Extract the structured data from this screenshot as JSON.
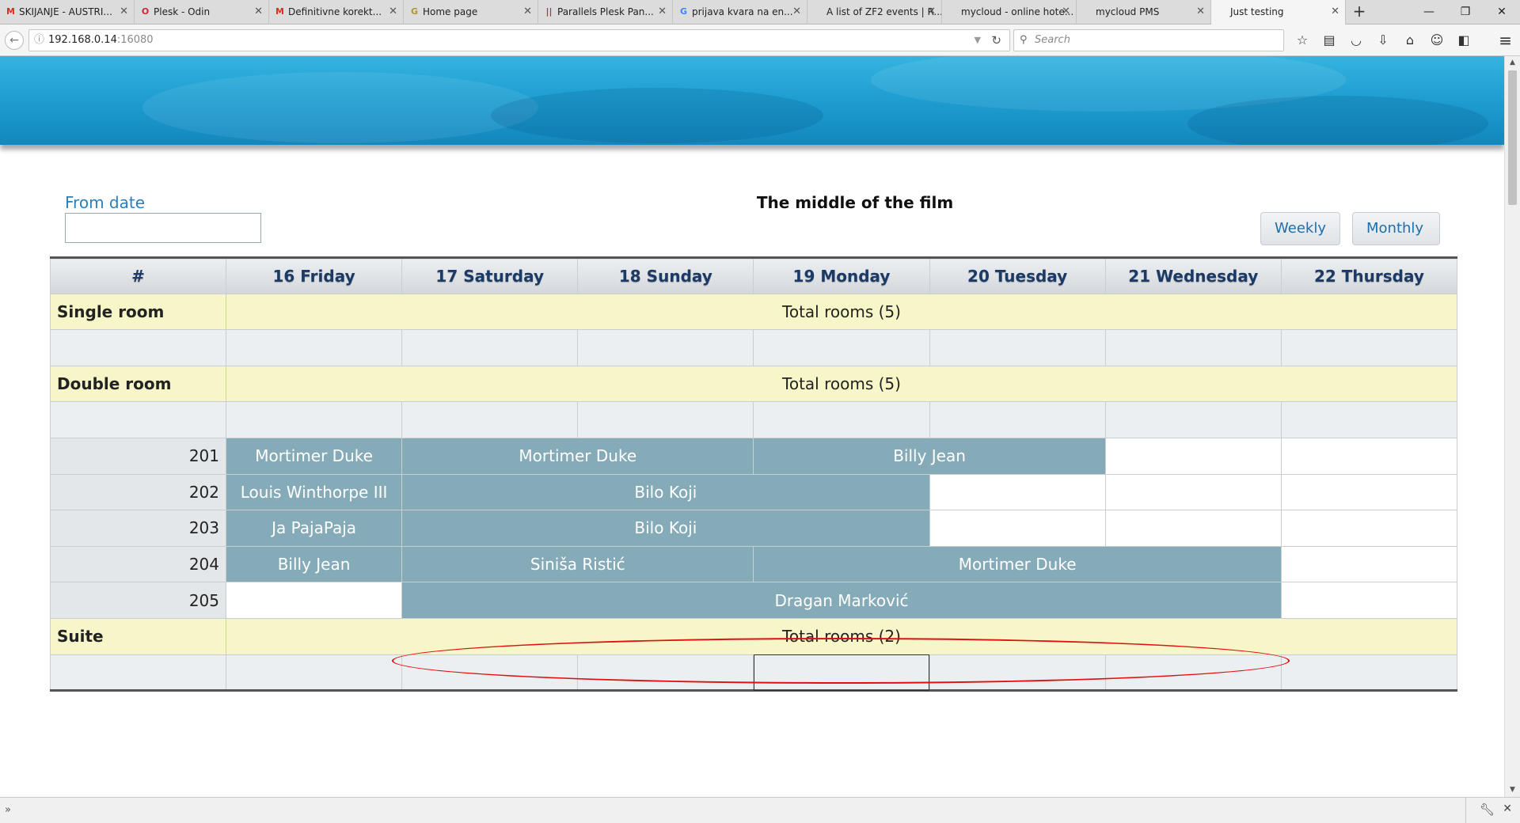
{
  "browser": {
    "tabs": [
      {
        "label": "SKIJANJE - AUSTRI...",
        "icon": "gmail-icon",
        "icon_glyph": "M",
        "icon_color": "#d93025"
      },
      {
        "label": "Plesk - Odin",
        "icon": "odin-icon",
        "icon_glyph": "O",
        "icon_color": "#c62a35"
      },
      {
        "label": "Definitivne korekt...",
        "icon": "gmail-icon",
        "icon_glyph": "M",
        "icon_color": "#d93025"
      },
      {
        "label": "Home page",
        "icon": "g-icon",
        "icon_glyph": "G",
        "icon_color": "#b0923a"
      },
      {
        "label": "Parallels Plesk Pan...",
        "icon": "parallels-icon",
        "icon_glyph": "||",
        "icon_color": "#d8232a"
      },
      {
        "label": "prijava kvara na en...",
        "icon": "google-icon",
        "icon_glyph": "G",
        "icon_color": "#4285f4"
      },
      {
        "label": "A list of ZF2 events | R...",
        "icon": "",
        "icon_glyph": "",
        "icon_color": "#333"
      },
      {
        "label": "mycloud - online hote...",
        "icon": "",
        "icon_glyph": "",
        "icon_color": "#333"
      },
      {
        "label": "mycloud PMS",
        "icon": "",
        "icon_glyph": "",
        "icon_color": "#333"
      },
      {
        "label": "Just testing",
        "icon": "",
        "icon_glyph": "",
        "icon_color": "#333",
        "active": true
      }
    ],
    "url_host": "192.168.0.14",
    "url_port": ":16080",
    "search_placeholder": "Search"
  },
  "page": {
    "from_date_label": "From date",
    "from_date_value": "",
    "title": "The middle of the film",
    "weekly_label": "Weekly",
    "monthly_label": "Monthly"
  },
  "calendar": {
    "header_hash": "#",
    "days": [
      "16 Friday",
      "17 Saturday",
      "18 Sunday",
      "19 Monday",
      "20 Tuesday",
      "21 Wednesday",
      "22 Thursday"
    ],
    "reservation_color": "#86abb8",
    "sections": [
      {
        "type": "Single room",
        "total": "Total rooms (5)",
        "rooms": []
      },
      {
        "type": "Double room",
        "total": "Total rooms (5)",
        "rooms": [
          {
            "number": "201",
            "bookings": [
              {
                "guest": "Mortimer Duke",
                "start": 0,
                "span": 1
              },
              {
                "guest": "Mortimer Duke",
                "start": 1,
                "span": 2
              },
              {
                "guest": "Billy Jean",
                "start": 3,
                "span": 2
              }
            ]
          },
          {
            "number": "202",
            "bookings": [
              {
                "guest": "Louis Winthorpe III",
                "start": 0,
                "span": 1
              },
              {
                "guest": "Bilo Koji",
                "start": 1,
                "span": 3
              }
            ]
          },
          {
            "number": "203",
            "bookings": [
              {
                "guest": "Ja PajaPaja",
                "start": 0,
                "span": 1
              },
              {
                "guest": "Bilo Koji",
                "start": 1,
                "span": 3
              }
            ]
          },
          {
            "number": "204",
            "bookings": [
              {
                "guest": "Billy Jean",
                "start": 0,
                "span": 1
              },
              {
                "guest": "Siniša Ristić",
                "start": 1,
                "span": 2
              },
              {
                "guest": "Mortimer Duke",
                "start": 3,
                "span": 3
              }
            ]
          },
          {
            "number": "205",
            "bookings": [
              {
                "guest": "Dragan Marković",
                "start": 1,
                "span": 5
              }
            ]
          }
        ]
      },
      {
        "type": "Suite",
        "total": "Total rooms (2)",
        "rooms": []
      }
    ]
  }
}
